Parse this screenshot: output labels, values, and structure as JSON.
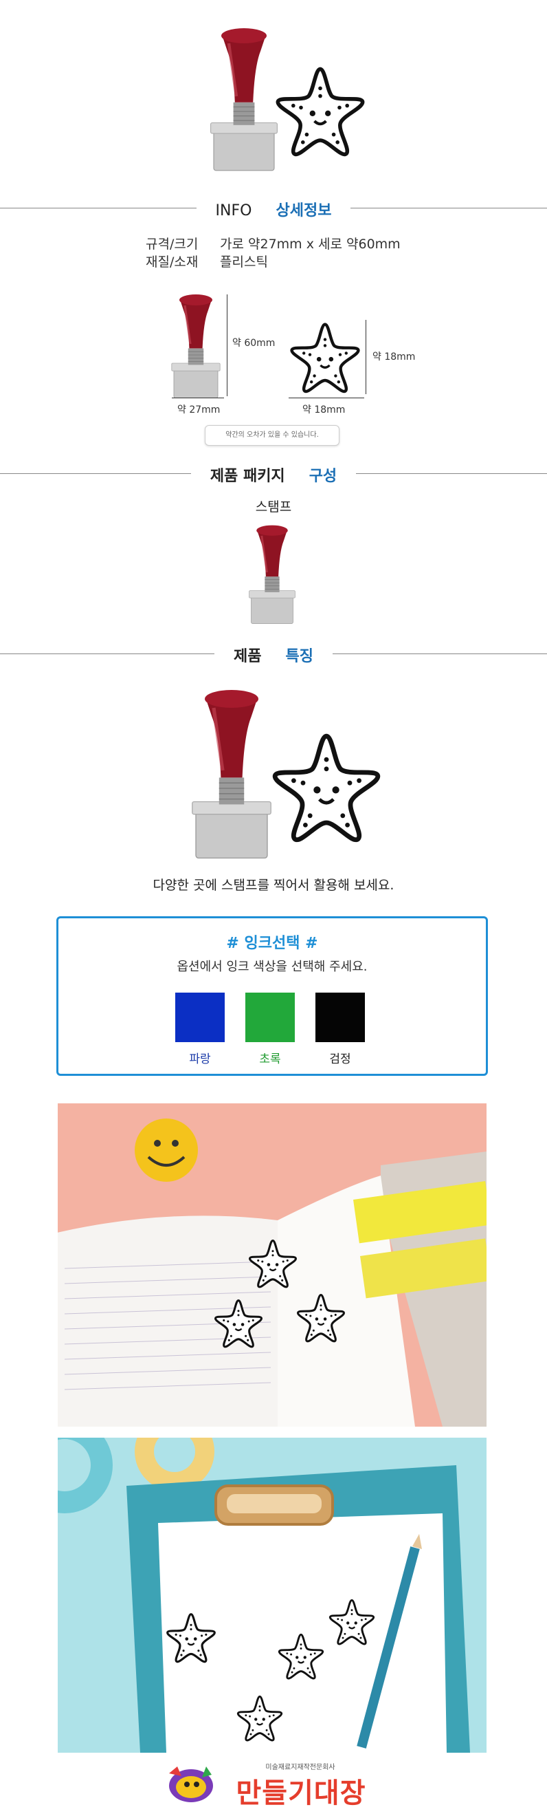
{
  "info": {
    "title_plain": "INFO",
    "title_accent": "상세정보"
  },
  "specs": [
    {
      "label": "규격/크기",
      "value": "가로 약27mm x 세로 약60mm"
    },
    {
      "label": "재질/소재",
      "value": "플리스틱"
    }
  ],
  "dimensions": {
    "stamp_height": "약 60mm",
    "stamp_width": "약 27mm",
    "star_height": "약 18mm",
    "star_width": "약 18mm"
  },
  "note": "약간의 오차가 있을 수 있습니다.",
  "package": {
    "title_plain": "제품 패키지",
    "title_accent": "구성",
    "item_label": "스탬프"
  },
  "feature": {
    "title_plain": "제품",
    "title_accent": "특징",
    "caption": "다양한 곳에 스탬프를 찍어서 활용해 보세요."
  },
  "ink": {
    "title": "# 잉크선택 #",
    "subtitle": "옵션에서 잉크 색상을 선택해 주세요.",
    "options": [
      {
        "label": "파랑",
        "color": "#0b2fc4",
        "label_color": "#1a3aa8"
      },
      {
        "label": "초록",
        "color": "#22a83a",
        "label_color": "#1e9a2e"
      },
      {
        "label": "검정",
        "color": "#050505",
        "label_color": "#222222"
      }
    ]
  },
  "brand": {
    "tagline": "미술재료지재작전문회사",
    "name": "만들기대장"
  }
}
